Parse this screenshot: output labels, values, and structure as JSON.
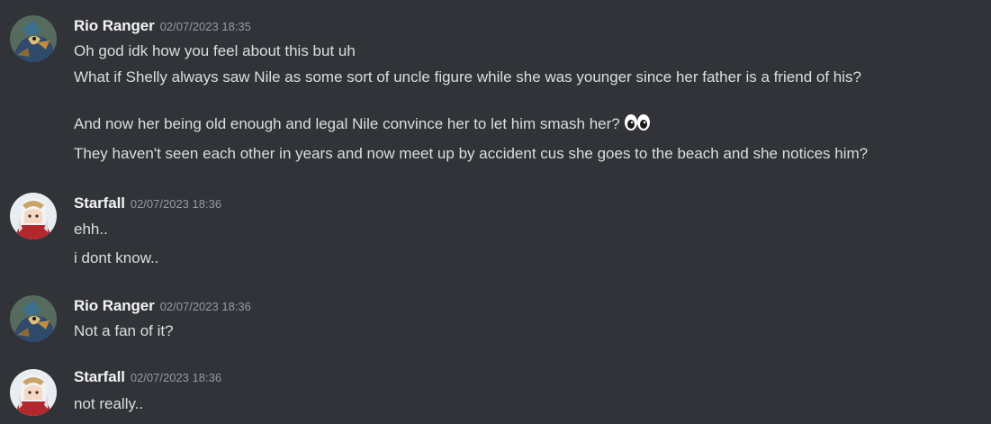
{
  "messages": [
    {
      "author": "Rio Ranger",
      "timestamp": "02/07/2023 18:35",
      "avatar": "rio-ranger-avatar",
      "lines": [
        "Oh god idk how you feel about this but uh",
        "What if Shelly always saw Nile as some sort of uncle figure while she was younger since her father is a friend of his?",
        "And now her being old enough and legal Nile convince her to let him smash her?",
        "They haven't seen each other in years and now meet up by accident cus she goes to the beach and she notices him?"
      ],
      "emoji": "eyes-emoji"
    },
    {
      "author": "Starfall",
      "timestamp": "02/07/2023 18:36",
      "avatar": "starfall-avatar",
      "lines": [
        "ehh..",
        "i dont know.."
      ]
    },
    {
      "author": "Rio Ranger",
      "timestamp": "02/07/2023 18:36",
      "avatar": "rio-ranger-avatar",
      "lines": [
        "Not a fan of it?"
      ]
    },
    {
      "author": "Starfall",
      "timestamp": "02/07/2023 18:36",
      "avatar": "starfall-avatar",
      "lines": [
        "not really.."
      ]
    }
  ],
  "colors": {
    "background": "#313338",
    "username": "#f2f3f5",
    "message_text": "#dbdee1",
    "timestamp": "#949ba4"
  }
}
